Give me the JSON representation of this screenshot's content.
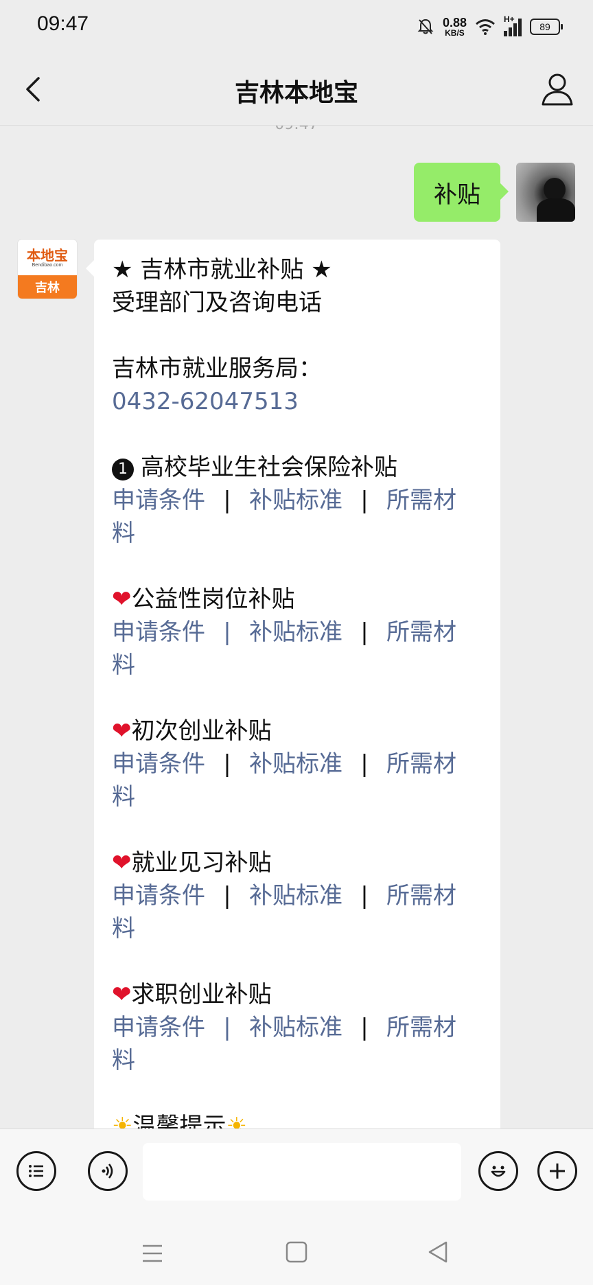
{
  "status_bar": {
    "time": "09:47",
    "net_speed_value": "0.88",
    "net_speed_unit": "KB/S",
    "network_type": "H+",
    "battery": "89"
  },
  "header": {
    "title": "吉林本地宝",
    "back_icon": "chevron-left-icon",
    "profile_icon": "user-icon"
  },
  "chat": {
    "timestamp": "09:47",
    "my_message": "补贴",
    "bot_avatar": {
      "logo_text": "本地宝",
      "logo_url": "Bendibao.com",
      "city": "吉林"
    },
    "bot_message": {
      "title": "★ 吉林市就业补贴 ★",
      "subtitle": "受理部门及咨询电话",
      "office": "吉林市就业服务局：",
      "phone": "0432-62047513",
      "sections": [
        {
          "marker": "❶",
          "name": "高校毕业生社会保险补贴"
        },
        {
          "marker": "❤️",
          "name": "公益性岗位补贴"
        },
        {
          "marker": "❤️",
          "name": "初次创业补贴"
        },
        {
          "marker": "❤️",
          "name": "就业见习补贴"
        },
        {
          "marker": "❤️",
          "name": "求职创业补贴"
        }
      ],
      "links": {
        "conditions": "申请条件",
        "standard": "补贴标准",
        "materials_line1": "所需材",
        "materials_line2": "料",
        "separator": "|"
      },
      "tip": "温馨提示",
      "tip_marker": "☀️"
    }
  },
  "input_bar": {
    "menu_icon": "list-menu-icon",
    "voice_icon": "voice-icon",
    "emoji_icon": "emoji-icon",
    "add_icon": "plus-icon"
  },
  "system_nav": {
    "menu_icon": "menu-icon",
    "home_icon": "home-square-icon",
    "back_icon": "back-triangle-icon"
  },
  "colors": {
    "my_bubble": "#95ec69",
    "link": "#576b95",
    "background": "#ededed",
    "brand_orange": "#f47a1f"
  }
}
